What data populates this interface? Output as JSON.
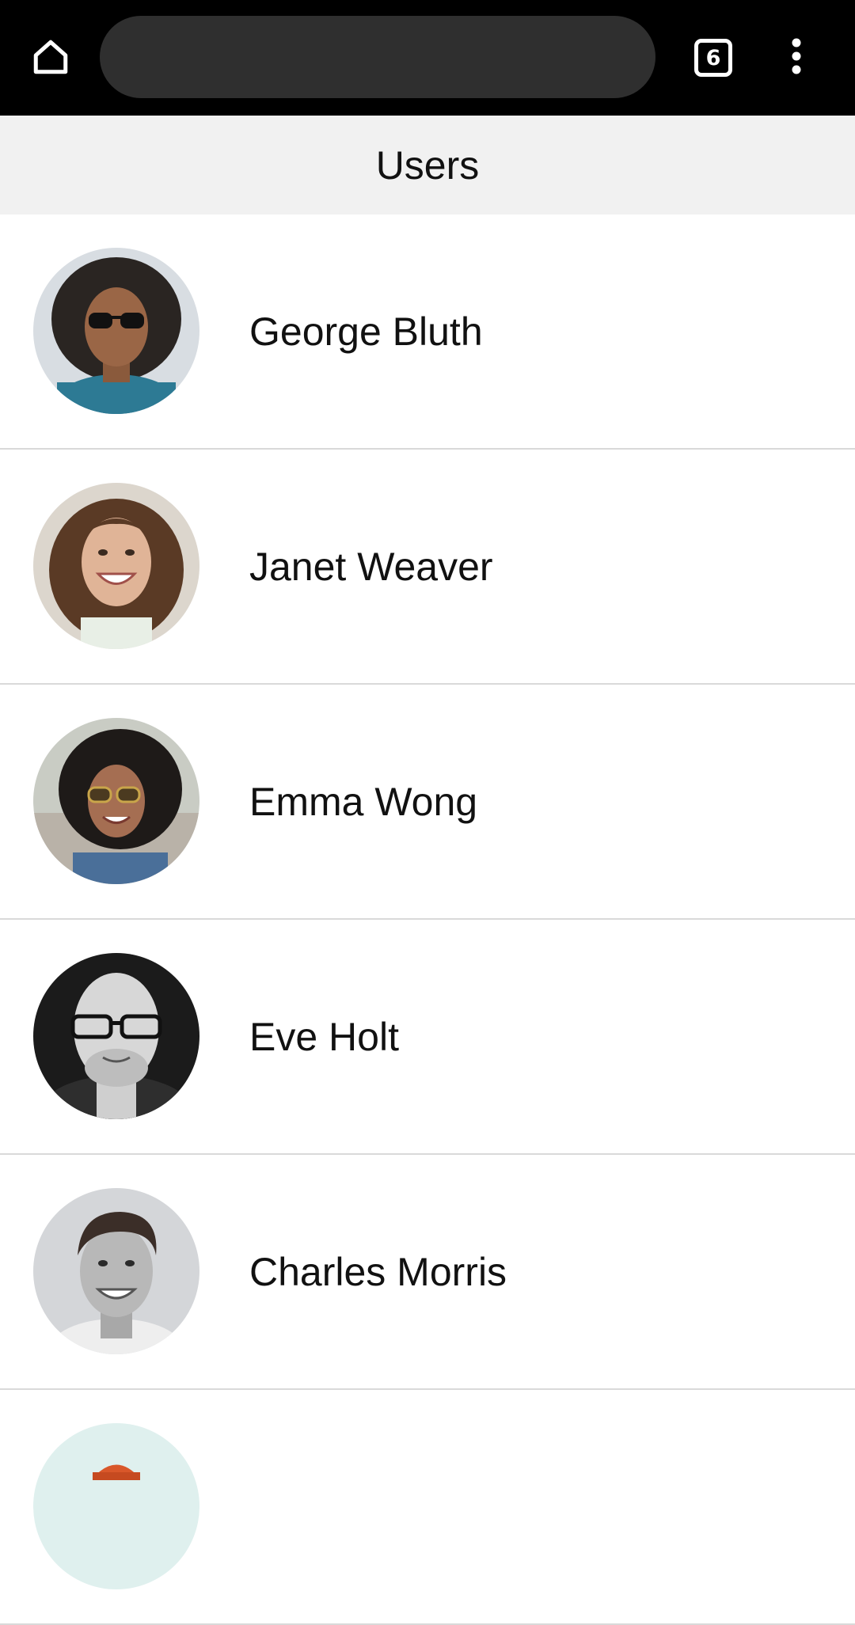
{
  "browser": {
    "url_text": "",
    "tab_count": "6",
    "icons": {
      "home": "home-icon",
      "tabs": "tab-switcher-icon",
      "menu": "more-vert-icon"
    }
  },
  "header": {
    "title": "Users"
  },
  "users": [
    {
      "name": "George Bluth",
      "avatar": "avatar-photo"
    },
    {
      "name": "Janet Weaver",
      "avatar": "avatar-photo"
    },
    {
      "name": "Emma Wong",
      "avatar": "avatar-photo"
    },
    {
      "name": "Eve Holt",
      "avatar": "avatar-photo"
    },
    {
      "name": "Charles Morris",
      "avatar": "avatar-photo"
    },
    {
      "name": "",
      "avatar": "avatar-photo"
    }
  ],
  "colors": {
    "toolbar_bg": "#000000",
    "url_bar_bg": "#2f2f2f",
    "header_bg": "#f1f1f1",
    "divider": "#d9d9d9",
    "text": "#111111"
  }
}
